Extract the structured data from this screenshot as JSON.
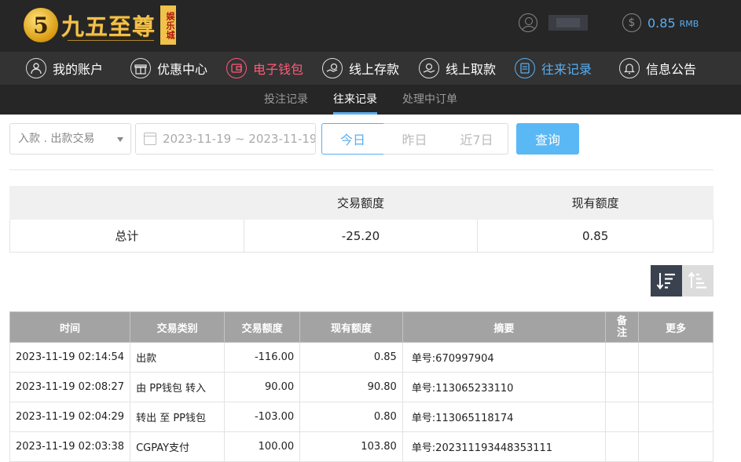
{
  "header": {
    "logo_mark": "5",
    "logo_text": "九五至尊",
    "logo_badge": "娱乐城",
    "balance_amount": "0.85",
    "balance_unit": "RMB"
  },
  "nav": {
    "items": [
      {
        "label": "我的账户",
        "icon": "user-icon"
      },
      {
        "label": "优惠中心",
        "icon": "gift-icon"
      },
      {
        "label": "电子钱包",
        "icon": "wallet-icon"
      },
      {
        "label": "线上存款",
        "icon": "deposit-icon"
      },
      {
        "label": "线上取款",
        "icon": "withdraw-icon"
      },
      {
        "label": "往来记录",
        "icon": "records-icon"
      },
      {
        "label": "信息公告",
        "icon": "bell-icon"
      }
    ]
  },
  "subnav": {
    "items": [
      {
        "label": "投注记录"
      },
      {
        "label": "往来记录"
      },
      {
        "label": "处理中订单"
      }
    ]
  },
  "filters": {
    "type_select": "入款 . 出款交易",
    "date_range": "2023-11-19 ~ 2023-11-19",
    "today": "今日",
    "yesterday": "昨日",
    "last7": "近7日",
    "query": "查询"
  },
  "summary": {
    "col_amount": "交易额度",
    "col_balance": "现有额度",
    "row_label": "总计",
    "amount": "-25.20",
    "balance": "0.85"
  },
  "records": {
    "headers": {
      "time": "时间",
      "type": "交易类别",
      "amount": "交易额度",
      "balance": "现有额度",
      "summary": "摘要",
      "note": "备注",
      "more": "更多"
    },
    "rows": [
      {
        "time": "2023-11-19 02:14:54",
        "type": "出款",
        "amount": "-116.00",
        "balance": "0.85",
        "summary": "单号:670997904"
      },
      {
        "time": "2023-11-19 02:08:27",
        "type": "由 PP钱包 转入",
        "amount": "90.00",
        "balance": "90.80",
        "summary": "单号:113065233110"
      },
      {
        "time": "2023-11-19 02:04:29",
        "type": "转出 至 PP钱包",
        "amount": "-103.00",
        "balance": "0.80",
        "summary": "单号:113065118174"
      },
      {
        "time": "2023-11-19 02:03:38",
        "type": "CGPAY支付",
        "amount": "100.00",
        "balance": "103.80",
        "summary": "单号:202311193448353111"
      }
    ]
  },
  "colors": {
    "accent_blue": "#5aaef0",
    "accent_red": "#ff5a7a",
    "header_bg": "#262626",
    "nav_bg": "#333333"
  }
}
